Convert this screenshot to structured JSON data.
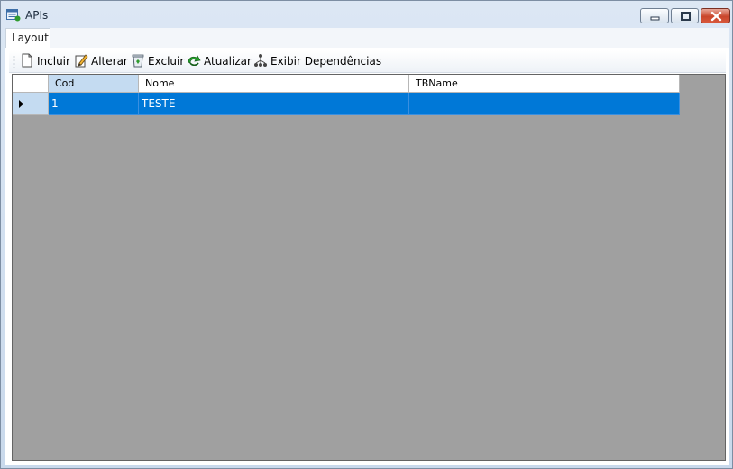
{
  "window": {
    "title": "APIs",
    "controls": {
      "minimize": "minimize",
      "maximize": "maximize",
      "close": "close"
    }
  },
  "tabs": [
    {
      "label": "Layout",
      "selected": true
    }
  ],
  "toolbar": {
    "items": [
      {
        "label": "Incluir",
        "icon": "new-document-icon"
      },
      {
        "label": "Alterar",
        "icon": "edit-pencil-icon"
      },
      {
        "label": "Excluir",
        "icon": "recycle-bin-icon"
      },
      {
        "label": "Atualizar",
        "icon": "refresh-arrow-icon"
      },
      {
        "label": "Exibir Dependências",
        "icon": "hierarchy-tree-icon"
      }
    ]
  },
  "grid": {
    "columns": [
      "Cod",
      "Nome",
      "TBName"
    ],
    "rows": [
      {
        "cod": "1",
        "nome": "TESTE",
        "tbname": "",
        "selected": true
      }
    ]
  },
  "colors": {
    "selection": "#0078d7",
    "grid_background": "#a0a0a0",
    "header_highlight": "#c4dbf1",
    "close_button": "#c9462c"
  }
}
